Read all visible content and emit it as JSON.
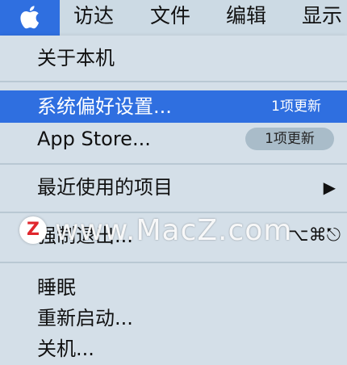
{
  "menubar": {
    "apple_icon": "apple-logo-icon",
    "titles": [
      "访达",
      "文件",
      "编辑",
      "显示"
    ]
  },
  "menu": {
    "about": "关于本机",
    "preferences": {
      "label": "系统偏好设置...",
      "badge": "1项更新"
    },
    "appstore": {
      "label": "App Store...",
      "badge": "1项更新"
    },
    "recent": {
      "label": "最近使用的项目",
      "arrow_icon": "submenu-arrow-icon"
    },
    "force_quit": {
      "label": "强制退出...",
      "shortcut": "⌥⌘⎋"
    },
    "sleep": "睡眠",
    "restart": "重新启动...",
    "shutdown": "关机..."
  },
  "watermark": {
    "text": "www.MacZ.com",
    "logo": "Z"
  },
  "colors": {
    "highlight": "#2f6fe0",
    "menu_bg": "#d4dfe8",
    "menubar_bg": "#ccdae4"
  }
}
